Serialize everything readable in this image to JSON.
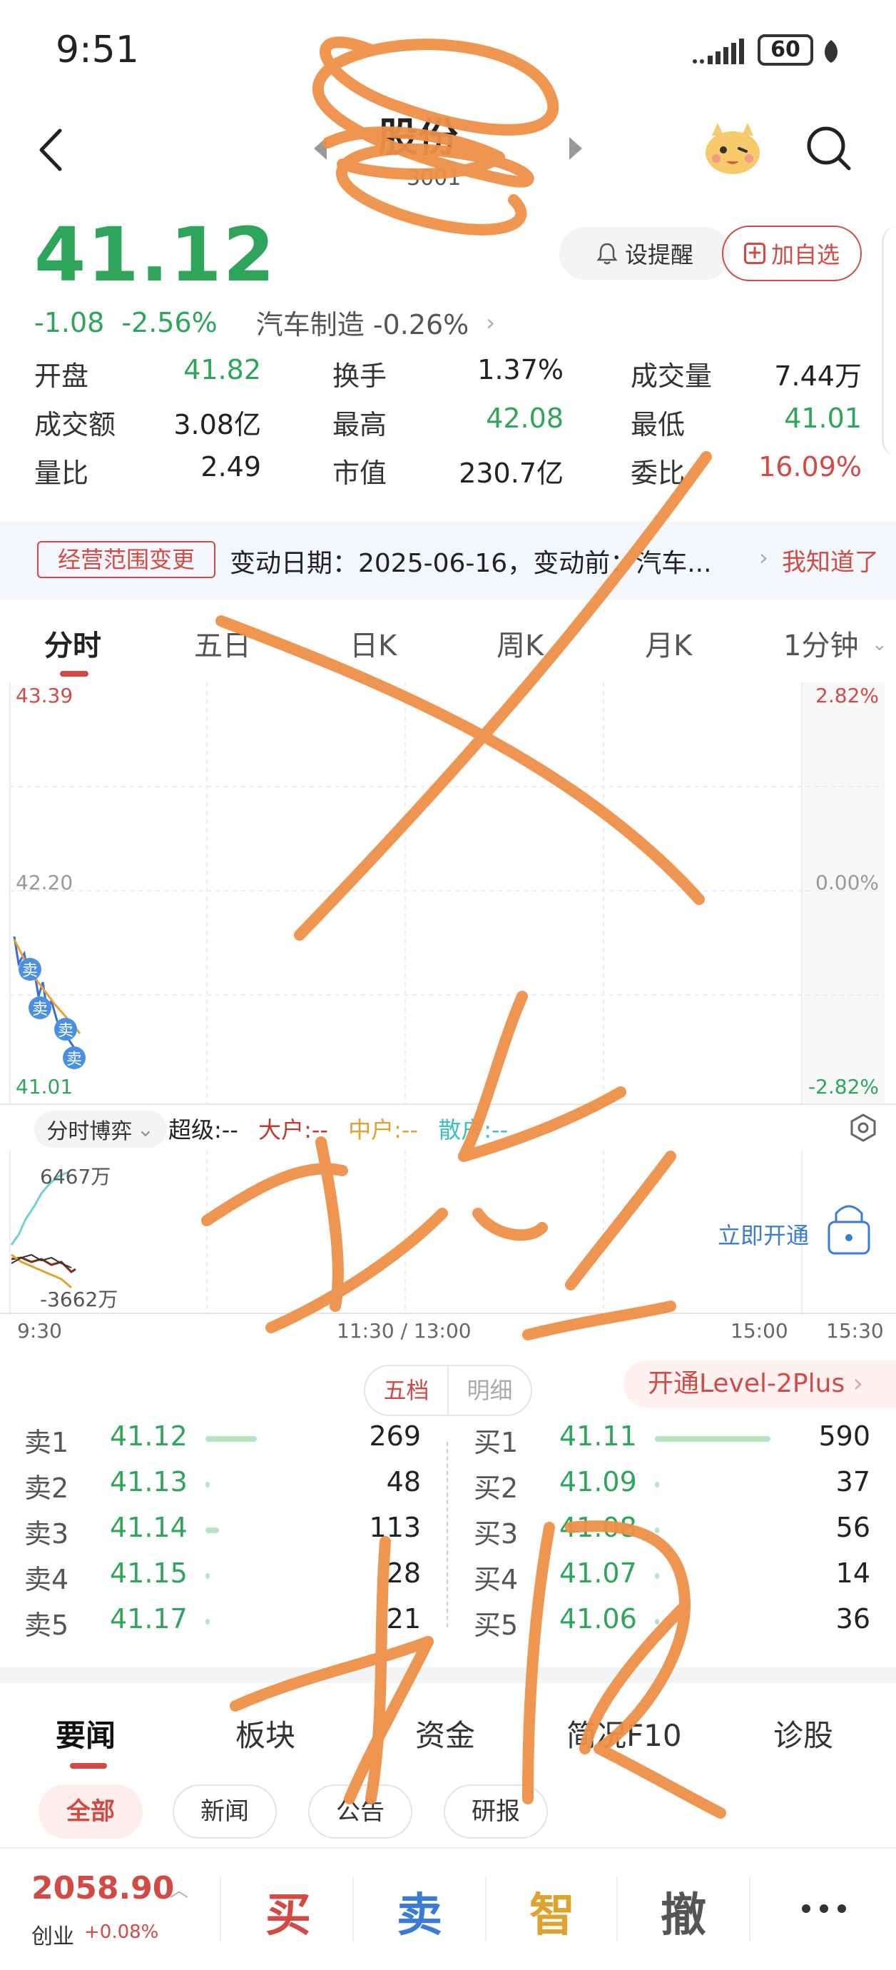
{
  "status_bar": {
    "time": "9:51",
    "battery": "60"
  },
  "header": {
    "stock_name": "股份",
    "stock_code": "3001"
  },
  "quote": {
    "price": "41.12",
    "change": "-1.08",
    "change_pct": "-2.56%",
    "sector": "汽车制造 -0.26%",
    "alert_label": "设提醒",
    "watch_label": "加自选"
  },
  "stats": [
    [
      {
        "label": "开盘",
        "value": "41.82",
        "color": "green"
      },
      {
        "label": "换手",
        "value": "1.37%",
        "color": "black"
      },
      {
        "label": "成交量",
        "value": "7.44万",
        "color": "black"
      }
    ],
    [
      {
        "label": "成交额",
        "value": "3.08亿",
        "color": "black"
      },
      {
        "label": "最高",
        "value": "42.08",
        "color": "green"
      },
      {
        "label": "最低",
        "value": "41.01",
        "color": "green"
      }
    ],
    [
      {
        "label": "量比",
        "value": "2.49",
        "color": "black"
      },
      {
        "label": "市值",
        "value": "230.7亿",
        "color": "black"
      },
      {
        "label": "委比",
        "value": "16.09%",
        "color": "red"
      }
    ]
  ],
  "notice": {
    "tag": "经营范围变更",
    "text": "变动日期：2025-06-16，变动前：汽车...",
    "ack": "我知道了"
  },
  "chart_tabs": [
    "分时",
    "五日",
    "日K",
    "周K",
    "月K",
    "1分钟"
  ],
  "chart": {
    "y_left": [
      "43.39",
      "42.20",
      "41.01"
    ],
    "y_right": [
      "2.82%",
      "0.00%",
      "-2.82%"
    ],
    "sell_marker": "卖"
  },
  "subchart": {
    "selector": "分时博弈",
    "legend": [
      "超级:--",
      "大户:--",
      "中户:--",
      "散户:--"
    ],
    "top_value": "6467万",
    "bottom_value": "-3662万",
    "unlock_label": "立即开通",
    "time_labels": [
      "9:30",
      "11:30 / 13:00",
      "15:00",
      "15:30"
    ]
  },
  "order_book": {
    "tabs": [
      "五档",
      "明细"
    ],
    "level2": "开通Level-2Plus",
    "sell": [
      {
        "label": "卖1",
        "price": "41.12",
        "vol": "269",
        "bar": 0.38
      },
      {
        "label": "卖2",
        "price": "41.13",
        "vol": "48",
        "bar": 0.02
      },
      {
        "label": "卖3",
        "price": "41.14",
        "vol": "113",
        "bar": 0.1
      },
      {
        "label": "卖4",
        "price": "41.15",
        "vol": "28",
        "bar": 0.01
      },
      {
        "label": "卖5",
        "price": "41.17",
        "vol": "21",
        "bar": 0.01
      }
    ],
    "buy": [
      {
        "label": "买1",
        "price": "41.11",
        "vol": "590",
        "bar": 0.85
      },
      {
        "label": "买2",
        "price": "41.09",
        "vol": "37",
        "bar": 0.02
      },
      {
        "label": "买3",
        "price": "41.08",
        "vol": "56",
        "bar": 0.02
      },
      {
        "label": "买4",
        "price": "41.07",
        "vol": "14",
        "bar": 0.01
      },
      {
        "label": "买5",
        "price": "41.06",
        "vol": "36",
        "bar": 0.02
      }
    ]
  },
  "news_tabs": [
    "要闻",
    "板块",
    "资金",
    "简况F10",
    "诊股"
  ],
  "news_chips": [
    "全部",
    "新闻",
    "公告",
    "研报"
  ],
  "bottom": {
    "index_value": "2058.90",
    "index_name": "创业",
    "index_change": "+0.08%",
    "buy": "买",
    "sell": "卖",
    "smart": "智",
    "cancel": "撤"
  },
  "colors": {
    "up": "#d34a44",
    "down": "#2ea55a",
    "scribble": "#ee9048"
  }
}
